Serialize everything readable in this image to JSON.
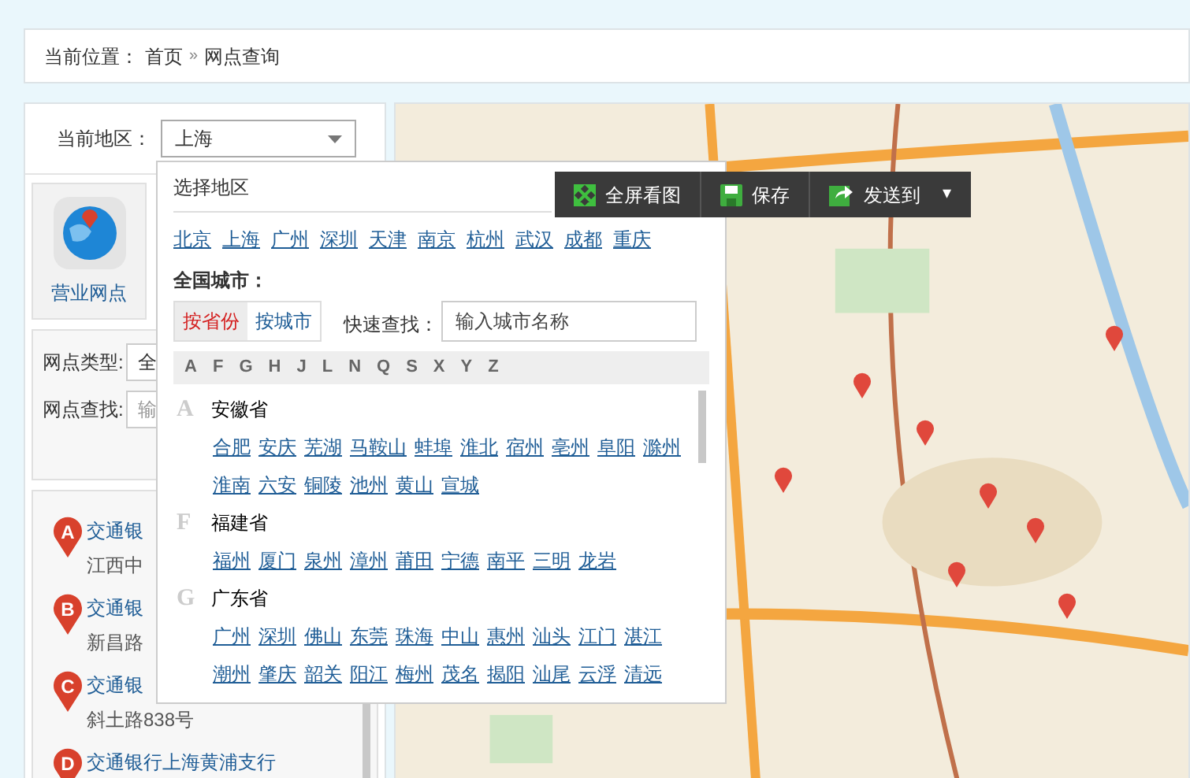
{
  "breadcrumb": {
    "label": "当前位置：",
    "items": [
      "首页",
      "网点查询"
    ],
    "separator": "»"
  },
  "region": {
    "label": "当前地区：",
    "value": "上海"
  },
  "service_tile": {
    "label": "营业网点"
  },
  "filters": [
    {
      "label": "网点类型:",
      "value": "全"
    },
    {
      "label": "网点查找:",
      "placeholder": "输"
    }
  ],
  "branches": [
    {
      "marker": "A",
      "name": "交通银",
      "address": "江西中"
    },
    {
      "marker": "B",
      "name": "交通银",
      "address": "新昌路"
    },
    {
      "marker": "C",
      "name": "交通银",
      "address": "斜土路838号"
    },
    {
      "marker": "D",
      "name": "交通银行上海黄浦支行"
    }
  ],
  "map_toolbar": [
    {
      "kind": "fullscreen",
      "label": "全屏看图"
    },
    {
      "kind": "save",
      "label": "保存"
    },
    {
      "kind": "send",
      "label": "发送到",
      "dropdown": "▾"
    }
  ],
  "region_picker": {
    "title": "选择地区",
    "hot_cities": [
      "北京",
      "上海",
      "广州",
      "深圳",
      "天津",
      "南京",
      "杭州",
      "武汉",
      "成都",
      "重庆"
    ],
    "all_label": "全国城市：",
    "tabs": [
      {
        "label": "按省份",
        "selected": true
      },
      {
        "label": "按城市",
        "selected": false
      }
    ],
    "search": {
      "label": "快速查找：",
      "placeholder": "输入城市名称"
    },
    "letters": [
      "A",
      "F",
      "G",
      "H",
      "J",
      "L",
      "N",
      "Q",
      "S",
      "X",
      "Y",
      "Z"
    ],
    "provinces": [
      {
        "letter": "A",
        "name": "安徽省",
        "cities": [
          "合肥",
          "安庆",
          "芜湖",
          "马鞍山",
          "蚌埠",
          "淮北",
          "宿州",
          "亳州",
          "阜阳",
          "滁州",
          "淮南",
          "六安",
          "铜陵",
          "池州",
          "黄山",
          "宣城"
        ]
      },
      {
        "letter": "F",
        "name": "福建省",
        "cities": [
          "福州",
          "厦门",
          "泉州",
          "漳州",
          "莆田",
          "宁德",
          "南平",
          "三明",
          "龙岩"
        ]
      },
      {
        "letter": "G",
        "name": "广东省",
        "cities": [
          "广州",
          "深圳",
          "佛山",
          "东莞",
          "珠海",
          "中山",
          "惠州",
          "汕头",
          "江门",
          "湛江",
          "潮州",
          "肇庆",
          "韶关",
          "阳江",
          "梅州",
          "茂名",
          "揭阳",
          "汕尾",
          "云浮",
          "清远"
        ]
      }
    ]
  }
}
